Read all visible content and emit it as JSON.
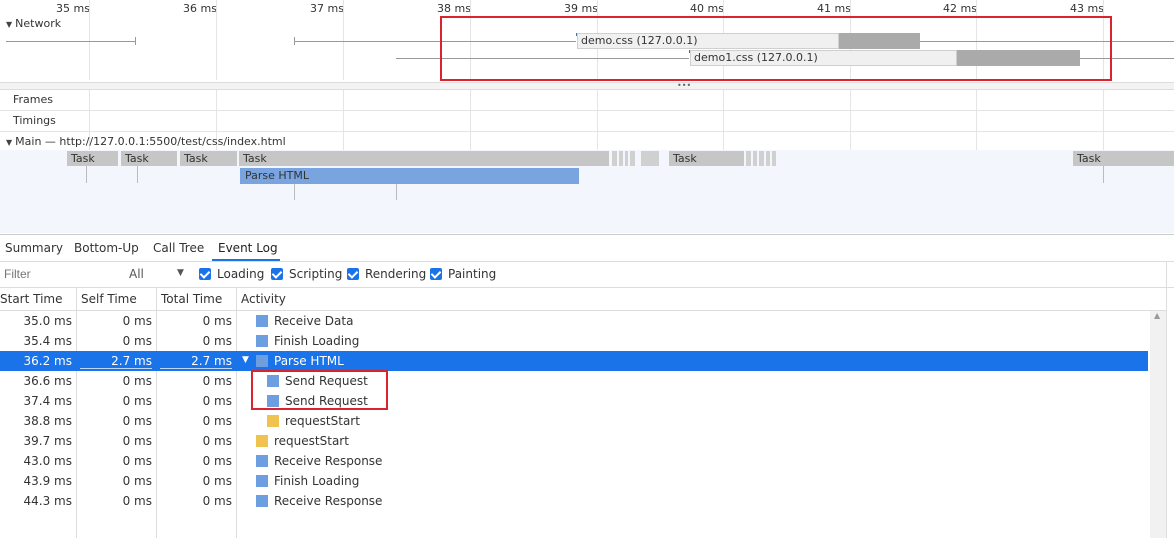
{
  "ruler": {
    "ticks": [
      "35 ms",
      "36 ms",
      "37 ms",
      "38 ms",
      "39 ms",
      "40 ms",
      "41 ms",
      "42 ms",
      "43 ms"
    ]
  },
  "network": {
    "label": "Network",
    "bars": [
      {
        "name": "demo.css (127.0.0.1)"
      },
      {
        "name": "demo1.css (127.0.0.1)"
      }
    ]
  },
  "tracks": {
    "frames": "Frames",
    "timings": "Timings",
    "main": "Main — http://127.0.0.1:5500/test/css/index.html"
  },
  "tasks": {
    "task_label": "Task",
    "parse_label": "Parse HTML"
  },
  "tabs": [
    "Summary",
    "Bottom-Up",
    "Call Tree",
    "Event Log"
  ],
  "filter": {
    "placeholder": "Filter",
    "dropdown_value": "All",
    "checkboxes": [
      "Loading",
      "Scripting",
      "Rendering",
      "Painting"
    ]
  },
  "table": {
    "headers": [
      "Start Time",
      "Self Time",
      "Total Time",
      "Activity"
    ],
    "rows": [
      {
        "start": "35.0 ms",
        "self": "0 ms",
        "total": "0 ms",
        "activity": "Receive Data",
        "color": "#6c9ee0"
      },
      {
        "start": "35.4 ms",
        "self": "0 ms",
        "total": "0 ms",
        "activity": "Finish Loading",
        "color": "#6c9ee0"
      },
      {
        "start": "36.2 ms",
        "self": "2.7 ms",
        "total": "2.7 ms",
        "activity": "Parse HTML",
        "color": "#6c9ee0"
      },
      {
        "start": "36.6 ms",
        "self": "0 ms",
        "total": "0 ms",
        "activity": "Send Request",
        "color": "#6c9ee0"
      },
      {
        "start": "37.4 ms",
        "self": "0 ms",
        "total": "0 ms",
        "activity": "Send Request",
        "color": "#6c9ee0"
      },
      {
        "start": "38.8 ms",
        "self": "0 ms",
        "total": "0 ms",
        "activity": "requestStart",
        "color": "#f0c24f"
      },
      {
        "start": "39.7 ms",
        "self": "0 ms",
        "total": "0 ms",
        "activity": "requestStart",
        "color": "#f0c24f"
      },
      {
        "start": "43.0 ms",
        "self": "0 ms",
        "total": "0 ms",
        "activity": "Receive Response",
        "color": "#6c9ee0"
      },
      {
        "start": "43.9 ms",
        "self": "0 ms",
        "total": "0 ms",
        "activity": "Finish Loading",
        "color": "#6c9ee0"
      },
      {
        "start": "44.3 ms",
        "self": "0 ms",
        "total": "0 ms",
        "activity": "Receive Response",
        "color": "#6c9ee0"
      }
    ]
  },
  "colors": {
    "selection": "#1a73e8",
    "highlight_box": "#d9242e",
    "accent": "#1a73e8"
  }
}
